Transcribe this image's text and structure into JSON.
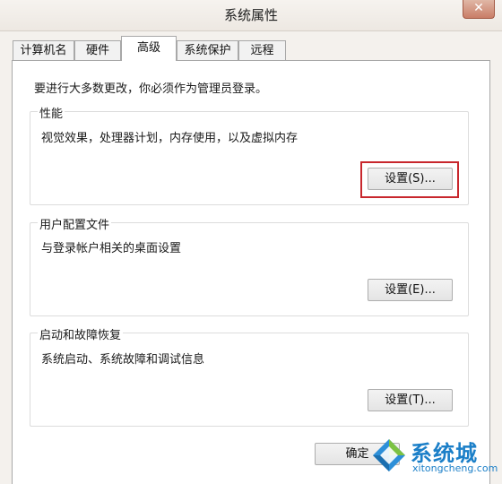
{
  "window": {
    "title": "系统属性",
    "close_symbol": "✕"
  },
  "tabs": [
    {
      "label": "计算机名",
      "active": false
    },
    {
      "label": "硬件",
      "active": false
    },
    {
      "label": "高级",
      "active": true
    },
    {
      "label": "系统保护",
      "active": false
    },
    {
      "label": "远程",
      "active": false
    }
  ],
  "notice": "要进行大多数更改，你必须作为管理员登录。",
  "performance": {
    "title": "性能",
    "description": "视觉效果，处理器计划，内存使用，以及虚拟内存",
    "button": "设置(S)..."
  },
  "user_profiles": {
    "title": "用户配置文件",
    "description": "与登录帐户相关的桌面设置",
    "button": "设置(E)..."
  },
  "startup_recovery": {
    "title": "启动和故障恢复",
    "description": "系统启动、系统故障和调试信息",
    "button": "设置(T)..."
  },
  "footer": {
    "ok_label": "确定"
  },
  "watermark": {
    "brand": "系统城",
    "url": "xitongcheng.com"
  },
  "colors": {
    "highlight": "#c8272d",
    "watermark": "#1b7fc8"
  }
}
